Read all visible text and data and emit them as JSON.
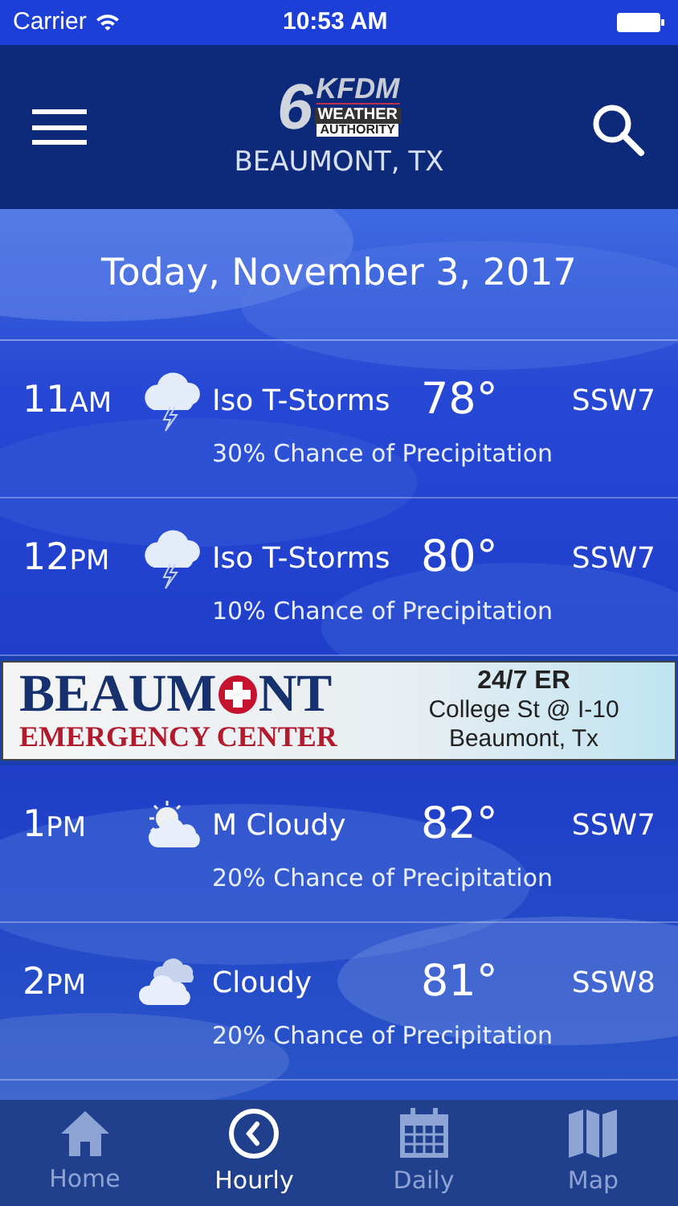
{
  "status_bar": {
    "carrier": "Carrier",
    "time": "10:53 AM"
  },
  "header": {
    "logo_number": "6",
    "logo_name": "KFDM",
    "logo_line_1": "WEATHER",
    "logo_line_2": "AUTHORITY",
    "location": "BEAUMONT, TX"
  },
  "date": "Today, November 3, 2017",
  "hours_before_ad": [
    {
      "hour": "11",
      "period": "AM",
      "kind": "storm",
      "condition": "Iso T-Storms",
      "temperature": "78°",
      "wind": "SSW7",
      "precipitation": "30% Chance of Precipitation"
    },
    {
      "hour": "12",
      "period": "PM",
      "kind": "storm",
      "condition": "Iso T-Storms",
      "temperature": "80°",
      "wind": "SSW7",
      "precipitation": "10% Chance of Precipitation"
    }
  ],
  "ad": {
    "brand_start": "BEAUM",
    "brand_end": "NT",
    "subtitle": "EMERGENCY CENTER",
    "headline": "24/7 ER",
    "address": "College St @ I-10",
    "city": "Beaumont, Tx"
  },
  "hours_after_ad": [
    {
      "hour": "1",
      "period": "PM",
      "kind": "partly-cloudy",
      "condition": "M Cloudy",
      "temperature": "82°",
      "wind": "SSW7",
      "precipitation": "20% Chance of Precipitation"
    },
    {
      "hour": "2",
      "period": "PM",
      "kind": "cloudy",
      "condition": "Cloudy",
      "temperature": "81°",
      "wind": "SSW8",
      "precipitation": "20% Chance of Precipitation"
    }
  ],
  "tabs": [
    {
      "label": "Home",
      "selected": false
    },
    {
      "label": "Hourly",
      "selected": true
    },
    {
      "label": "Daily",
      "selected": false
    },
    {
      "label": "Map",
      "selected": false
    }
  ]
}
